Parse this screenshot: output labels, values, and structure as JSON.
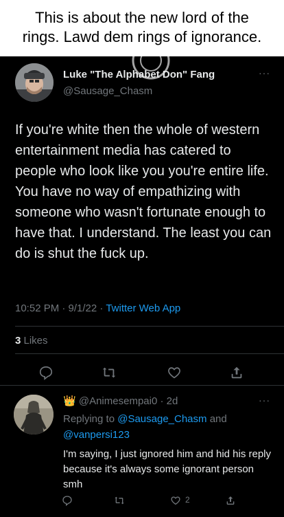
{
  "caption": {
    "line1": "This is about the new lord of the",
    "line2": "rings. Lawd dem rings of ignorance."
  },
  "tweet": {
    "display_name": "Luke \"The Alphabet Don\" Fang",
    "handle": "@Sausage_Chasm",
    "more_label": "···",
    "text": "If you're white then the whole of western entertainment media has catered to people who look like you you're entire life. You have no way of empathizing with someone who wasn't fortunate enough to have that. I understand. The least you can do is shut the fuck up.",
    "time": "10:52 PM · 9/1/22 · ",
    "source": "Twitter Web App",
    "likes_count": "3",
    "likes_label": " Likes",
    "icons": [
      "reply-icon",
      "retweet-icon",
      "like-icon",
      "share-icon"
    ]
  },
  "reply": {
    "badge": "👑",
    "handle": "@Animesempai0",
    "time": " · 2d",
    "more_label": "···",
    "replying_prefix": "Replying to ",
    "mention1": "@Sausage_Chasm",
    "and": " and",
    "mention2": "@vanpersi123",
    "text": "I'm saying, I just ignored him and hid his reply because it's always some ignorant person smh",
    "like_count": "2",
    "icons": [
      "reply-icon",
      "retweet-icon",
      "like-icon",
      "share-icon"
    ]
  },
  "colors": {
    "accent": "#1d9bf0",
    "muted": "#71767b",
    "text": "#e7e9ea",
    "background": "#000000",
    "divider": "#2f3336"
  }
}
